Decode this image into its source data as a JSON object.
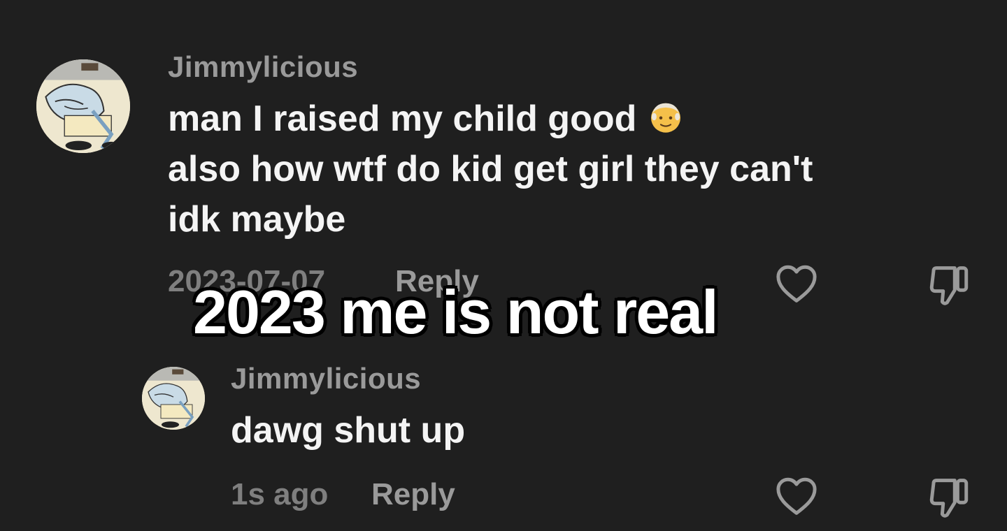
{
  "main_comment": {
    "username": "Jimmylicious",
    "lines": [
      "man I raised my child good",
      "also how wtf do kid get girl they can't",
      "idk maybe"
    ],
    "emoji": "older-man-emoji",
    "date": "2023-07-07",
    "reply_label": "Reply"
  },
  "reply_comment": {
    "username": "Jimmylicious",
    "text": "dawg shut up",
    "time": "1s ago",
    "reply_label": "Reply"
  },
  "overlay": {
    "caption": "2023 me is not real"
  },
  "icons": {
    "like": "heart-outline-icon",
    "dislike": "thumbs-down-outline-icon"
  },
  "colors": {
    "background": "#1f1f1f",
    "username": "#9a9a9a",
    "text": "#f4f4f4",
    "meta": "#7f7f7f"
  }
}
